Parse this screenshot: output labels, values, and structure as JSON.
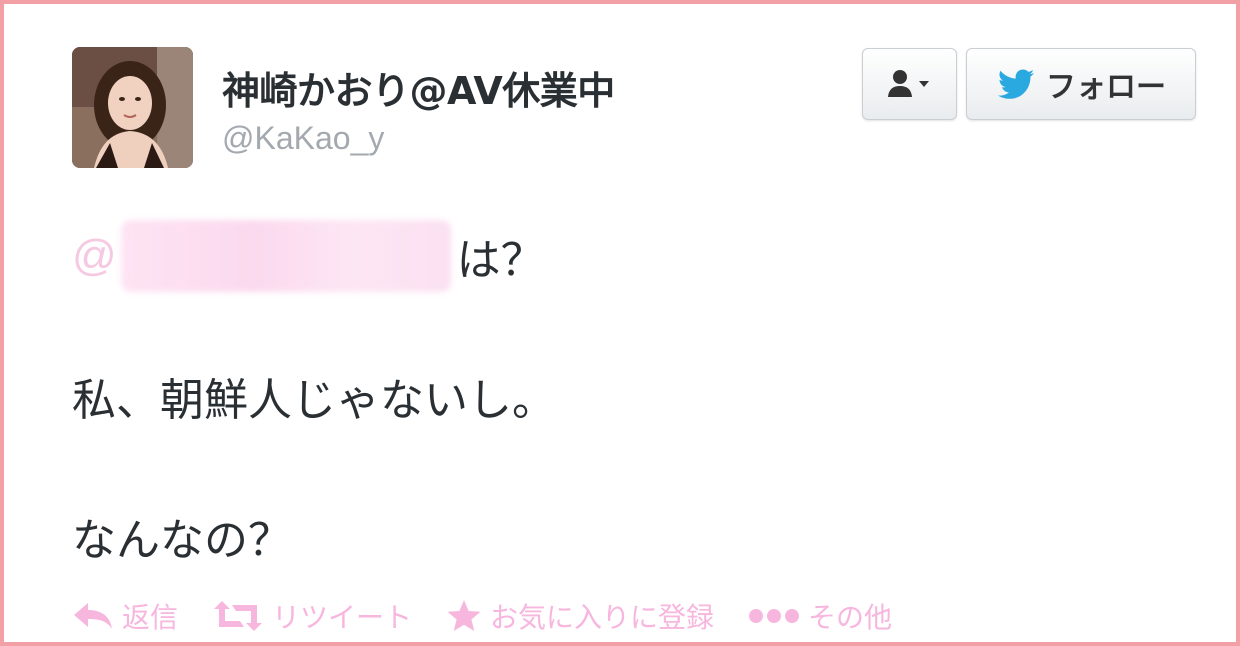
{
  "user": {
    "display_name": "神崎かおり@AV休業中",
    "handle": "@KaKao_y"
  },
  "buttons": {
    "user_menu_icon": "user-dropdown-icon",
    "follow_label": "フォロー",
    "follow_icon": "twitter-bird-icon"
  },
  "tweet": {
    "mention_at": "@",
    "line1_tail": "は？",
    "line2": "私、朝鮮人じゃないし。",
    "line3": "なんなの？"
  },
  "actions": {
    "reply": "返信",
    "retweet": "リツイート",
    "favorite": "お気に入りに登録",
    "more": "その他"
  },
  "colors": {
    "frame_border": "#f2a0a6",
    "action_pink": "#f7b6de",
    "twitter_blue": "#2aa9e0",
    "text": "#292f33",
    "handle_gray": "#a3a9ae"
  }
}
